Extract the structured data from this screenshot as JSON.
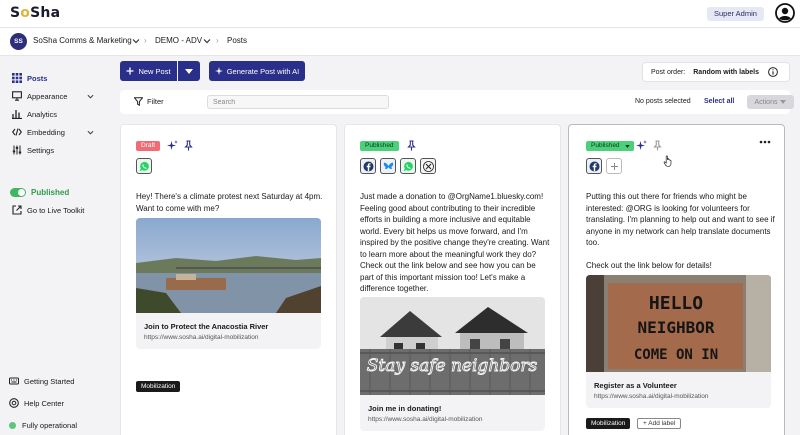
{
  "app": {
    "logo_prefix": "S",
    "logo_o": "o",
    "logo_suffix": "Sha",
    "role_badge": "Super Admin"
  },
  "breadcrumb": {
    "org_initials": "SS",
    "org_name": "SoSha Comms & Marketing",
    "project": "DEMO - ADV",
    "separator": "›",
    "page": "Posts"
  },
  "sidebar": {
    "items": [
      {
        "label": "Posts",
        "icon": "grid-icon",
        "active": true
      },
      {
        "label": "Appearance",
        "icon": "monitor-icon",
        "expandable": true
      },
      {
        "label": "Analytics",
        "icon": "chart-icon"
      },
      {
        "label": "Embedding",
        "icon": "code-icon",
        "expandable": true
      },
      {
        "label": "Settings",
        "icon": "sliders-icon"
      }
    ],
    "published_label": "Published",
    "live_toolkit": "Go to Live Toolkit",
    "getting_started": "Getting Started",
    "help_center": "Help Center",
    "status": "Fully operational"
  },
  "toolbar": {
    "new_post": "New Post",
    "generate_ai": "Generate Post with AI",
    "post_order_label": "Post order:",
    "post_order_value": "Random with labels"
  },
  "filter": {
    "label": "Filter",
    "search_placeholder": "Search",
    "selection_status": "No posts selected",
    "select_all": "Select all",
    "actions": "Actions"
  },
  "posts": [
    {
      "status": "Draft",
      "text": "Hey! There's a climate protest next Saturday at 4pm. Want to come with me?",
      "link_title": "Join to Protect the Anacostia River",
      "link_url": "https://www.sosha.ai/digital-mobilization",
      "labels": [
        "Mobilization"
      ]
    },
    {
      "status": "Published",
      "text": "Just made a donation to @OrgName1.bluesky.com! Feeling good about contributing to their incredible efforts in building a more inclusive and equitable world. Every bit helps us move forward, and I'm inspired by the positive change they're creating. Want to learn more about the meaningful work they do? Check out the link below and see how you can be part of this important mission too! Let's make a difference together.",
      "link_title": "Join me in donating!",
      "link_url": "https://www.sosha.ai/digital-mobilization",
      "image_text": "Stay safe neighbors"
    },
    {
      "status": "Published",
      "text": "Putting this out there for friends who might be interested: @ORG is looking for volunteers for translating. I'm planning to help out and want to see if anyone in my network can help translate documents too.\n\nCheck out the link below for details!",
      "link_title": "Register as a Volunteer",
      "link_url": "https://www.sosha.ai/digital-mobilization",
      "image_lines": [
        "HELLO",
        "NEIGHBOR",
        "COME ON IN"
      ],
      "labels": [
        "Mobilization"
      ],
      "add_label": "+ Add label"
    }
  ],
  "colors": {
    "primary": "#2a2f8a",
    "published": "#4dd07a",
    "draft": "#f06b74"
  }
}
